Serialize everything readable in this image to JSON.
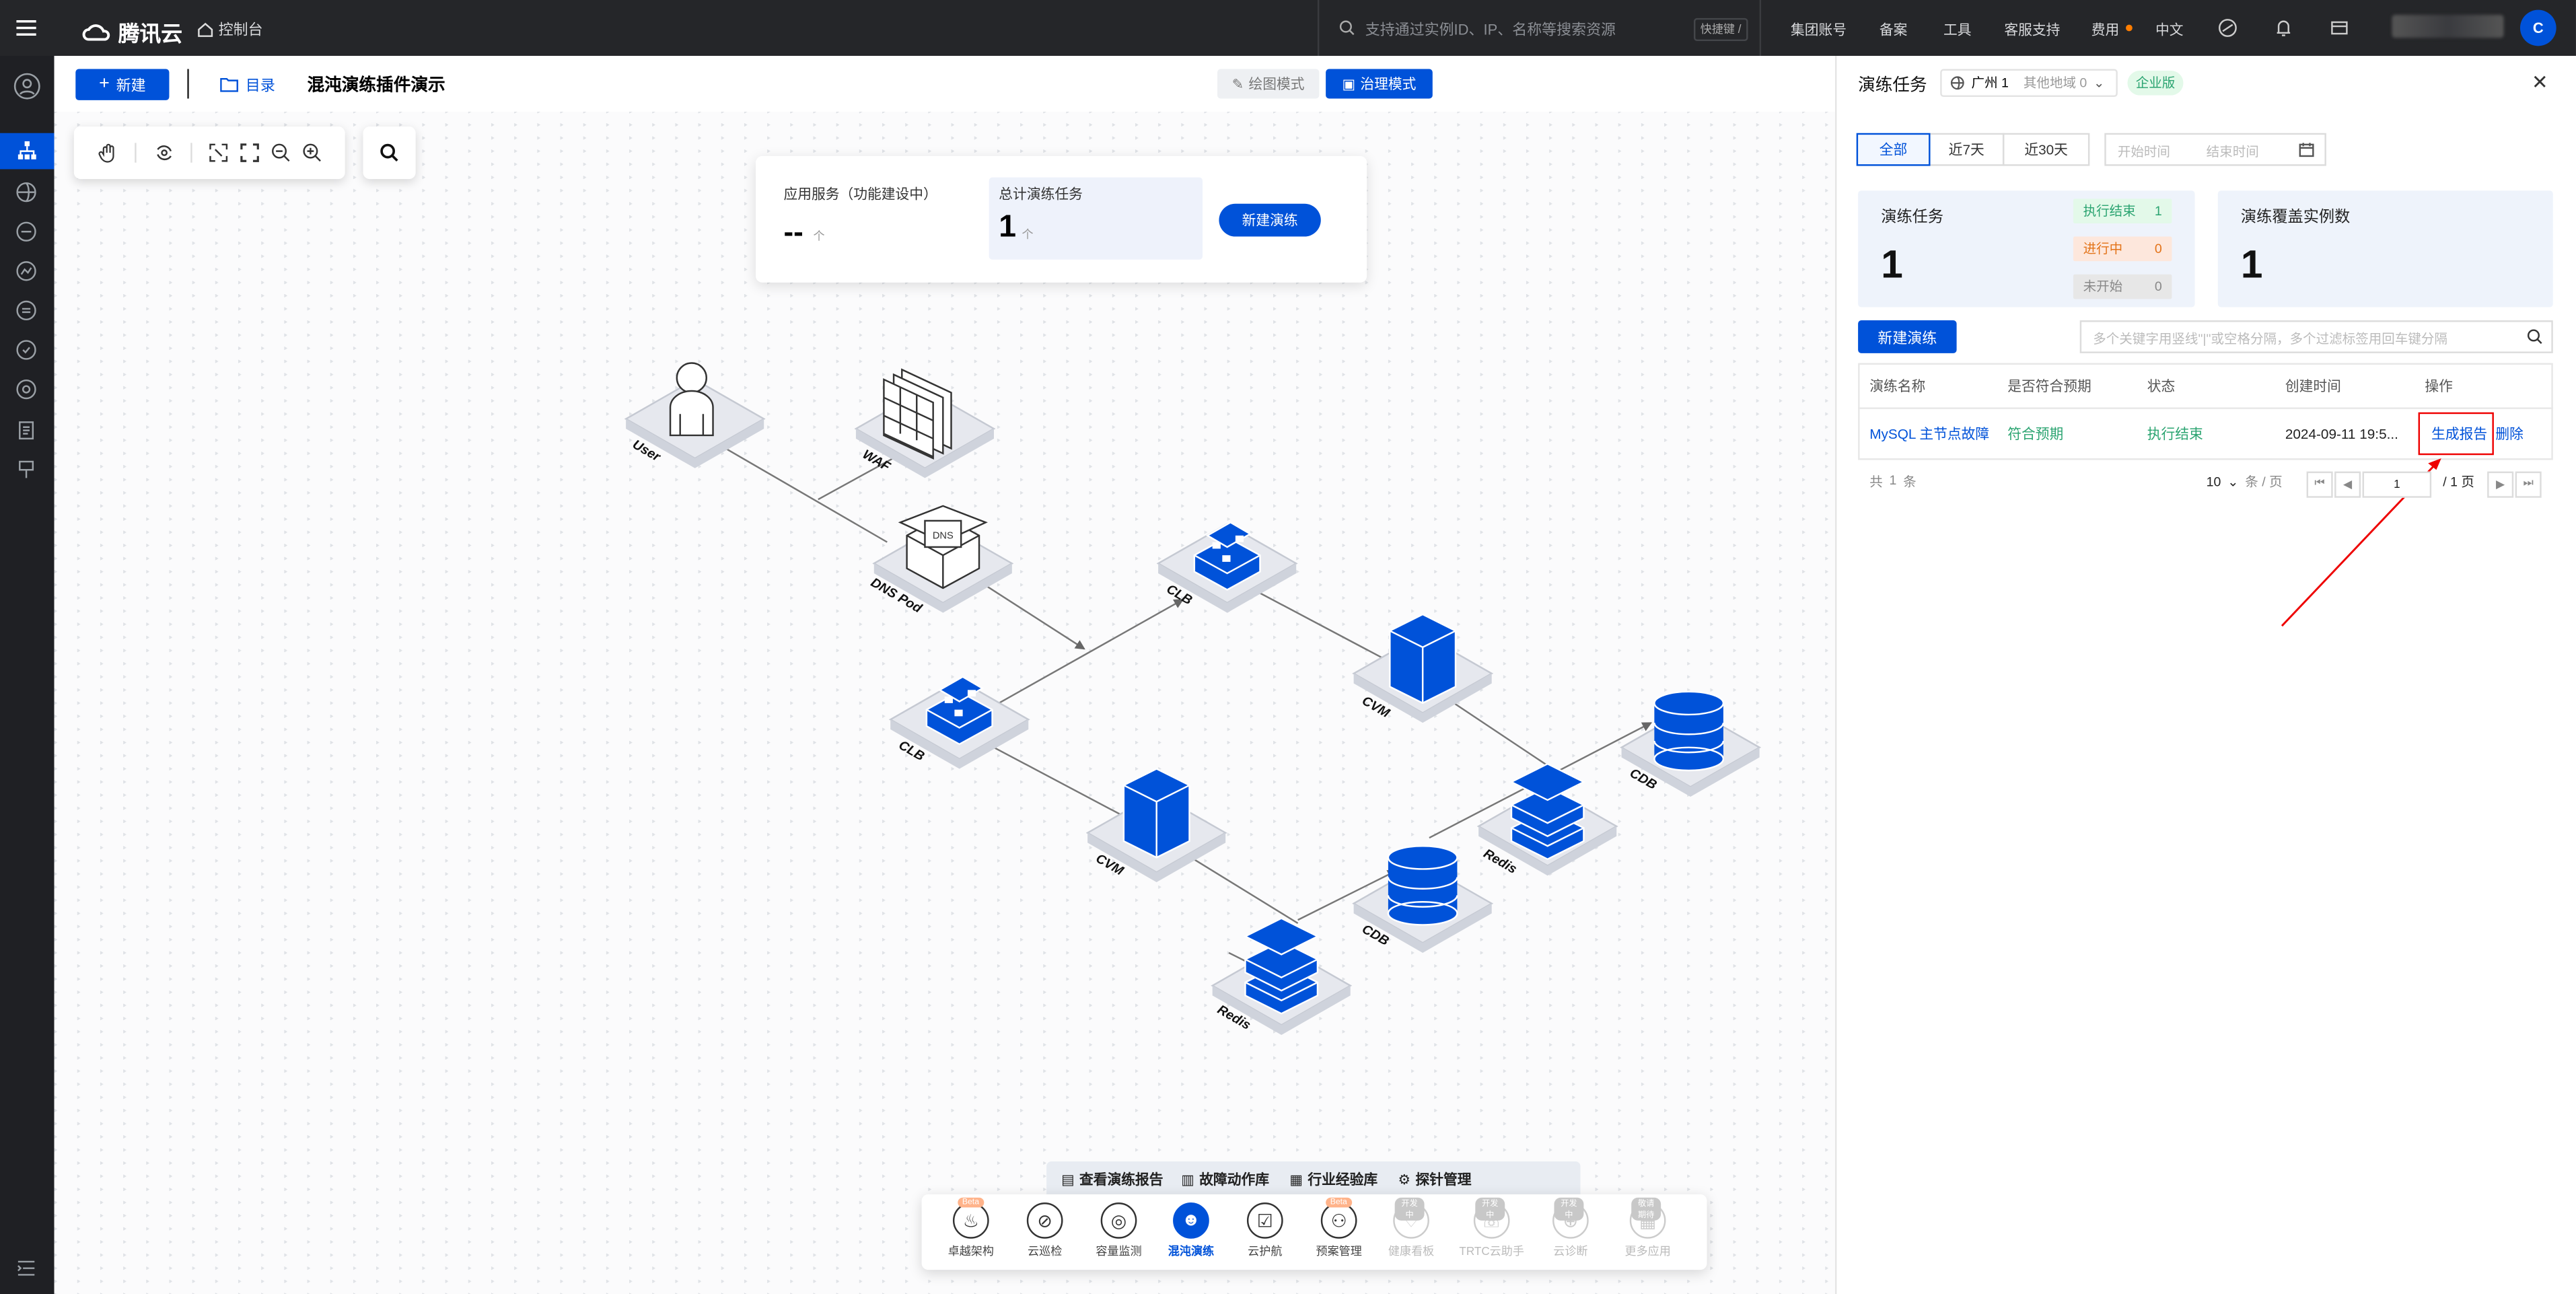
{
  "topbar": {
    "brand": "腾讯云",
    "console": "控制台",
    "search_placeholder": "支持通过实例ID、IP、名称等搜索资源",
    "shortcut": "快捷键 /",
    "nav": [
      "集团账号",
      "备案",
      "工具",
      "客服支持",
      "费用",
      "中文"
    ],
    "avatar_initial": "C"
  },
  "header": {
    "new_button": "新建",
    "catalog_button": "目录",
    "title": "混沌演练插件演示",
    "mode_draw": "绘图模式",
    "mode_govern": "治理模式"
  },
  "stats": {
    "app_service_label": "应用服务（功能建设中）",
    "app_service_value": "--",
    "app_service_unit": "个",
    "total_tasks_label": "总计演练任务",
    "total_tasks_value": "1",
    "total_tasks_unit": "个",
    "new_drill_button": "新建演练"
  },
  "diagram": {
    "nodes": [
      {
        "id": "user",
        "label": "User"
      },
      {
        "id": "waf",
        "label": "WAF"
      },
      {
        "id": "dnspod",
        "label": "DNS Pod"
      },
      {
        "id": "clb1",
        "label": "CLB"
      },
      {
        "id": "clb2",
        "label": "CLB"
      },
      {
        "id": "cvm1",
        "label": "CVM"
      },
      {
        "id": "cvm2",
        "label": "CVM"
      },
      {
        "id": "cdb1",
        "label": "CDB"
      },
      {
        "id": "cdb2",
        "label": "CDB"
      },
      {
        "id": "redis1",
        "label": "Redis"
      },
      {
        "id": "redis2",
        "label": "Redis"
      }
    ],
    "dns_text": "DNS"
  },
  "bottom_actions": [
    "查看演练报告",
    "故障动作库",
    "行业经验库",
    "探针管理"
  ],
  "dock": [
    {
      "label": "卓越架构",
      "badge": "Beta",
      "icon": "architecture-icon"
    },
    {
      "label": "云巡检",
      "badge": "",
      "icon": "inspect-icon"
    },
    {
      "label": "容量监测",
      "badge": "",
      "icon": "capacity-icon"
    },
    {
      "label": "混沌演练",
      "badge": "",
      "icon": "chaos-icon",
      "active": true
    },
    {
      "label": "云护航",
      "badge": "",
      "icon": "escort-icon"
    },
    {
      "label": "预案管理",
      "badge": "Beta",
      "icon": "plan-icon"
    },
    {
      "label": "健康看板",
      "badge": "开发中",
      "icon": "health-icon",
      "dim": true
    },
    {
      "label": "TRTC云助手",
      "badge": "开发中",
      "icon": "trtc-icon",
      "dim": true
    },
    {
      "label": "云诊断",
      "badge": "开发中",
      "icon": "diagnose-icon",
      "dim": true
    },
    {
      "label": "更多应用",
      "badge": "敬请期待",
      "icon": "more-apps-icon",
      "dim": true
    }
  ],
  "panel": {
    "title": "演练任务",
    "region": "广州 1",
    "other_region": "其他地域 0",
    "edition": "企业版",
    "tabs": [
      "全部",
      "近7天",
      "近30天"
    ],
    "start_placeholder": "开始时间",
    "end_placeholder": "结束时间",
    "kpi_tasks_label": "演练任务",
    "kpi_tasks_value": "1",
    "status_done": "执行结束",
    "status_done_count": "1",
    "status_running": "进行中",
    "status_running_count": "0",
    "status_pending": "未开始",
    "status_pending_count": "0",
    "kpi_instances_label": "演练覆盖实例数",
    "kpi_instances_value": "1",
    "new_drill_button": "新建演练",
    "filter_placeholder": "多个关键字用竖线\"|\"或空格分隔，多个过滤标签用回车键分隔",
    "columns": [
      "演练名称",
      "是否符合预期",
      "状态",
      "创建时间",
      "操作"
    ],
    "rows": [
      {
        "name": "MySQL 主节点故障",
        "expected": "符合预期",
        "status": "执行结束",
        "created": "2024-09-11 19:5...",
        "action_report": "生成报告",
        "action_delete": "删除"
      }
    ],
    "total_prefix": "共",
    "total_count": "1",
    "total_suffix": "条",
    "page_size": "10",
    "page_size_unit": "条 / 页",
    "page_current": "1",
    "page_total": "/ 1 页"
  },
  "colors": {
    "primary": "#0052d9",
    "success": "#2ba471",
    "warning": "#e37318",
    "highlight": "#e34d59"
  }
}
